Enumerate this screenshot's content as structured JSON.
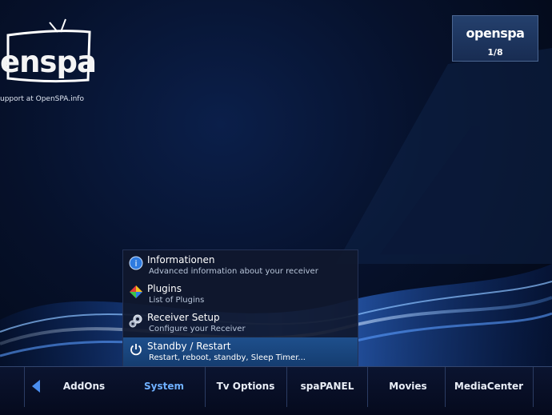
{
  "logo": {
    "text": "enspa",
    "support": "upport at OpenSPA.info"
  },
  "badge": {
    "logo": "openspa",
    "page": "1/8"
  },
  "menu": {
    "items": [
      {
        "title": "Informationen",
        "subtitle": "Advanced information about your receiver",
        "icon": "info-icon"
      },
      {
        "title": "Plugins",
        "subtitle": "List of Plugins",
        "icon": "plugins-icon"
      },
      {
        "title": "Receiver Setup",
        "subtitle": "Configure your Receiver",
        "icon": "gears-icon"
      },
      {
        "title": "Standby / Restart",
        "subtitle": "Restart, reboot, standby, Sleep Timer...",
        "icon": "power-icon"
      }
    ],
    "selected_index": 3
  },
  "bottom_bar": {
    "items": [
      "AddOns",
      "System",
      "Tv Options",
      "spaPANEL",
      "Movies",
      "MediaCenter"
    ],
    "active": "System"
  },
  "colors": {
    "accent": "#6fb0ff",
    "selected": "#1e4f8c",
    "background": "#06112b"
  }
}
